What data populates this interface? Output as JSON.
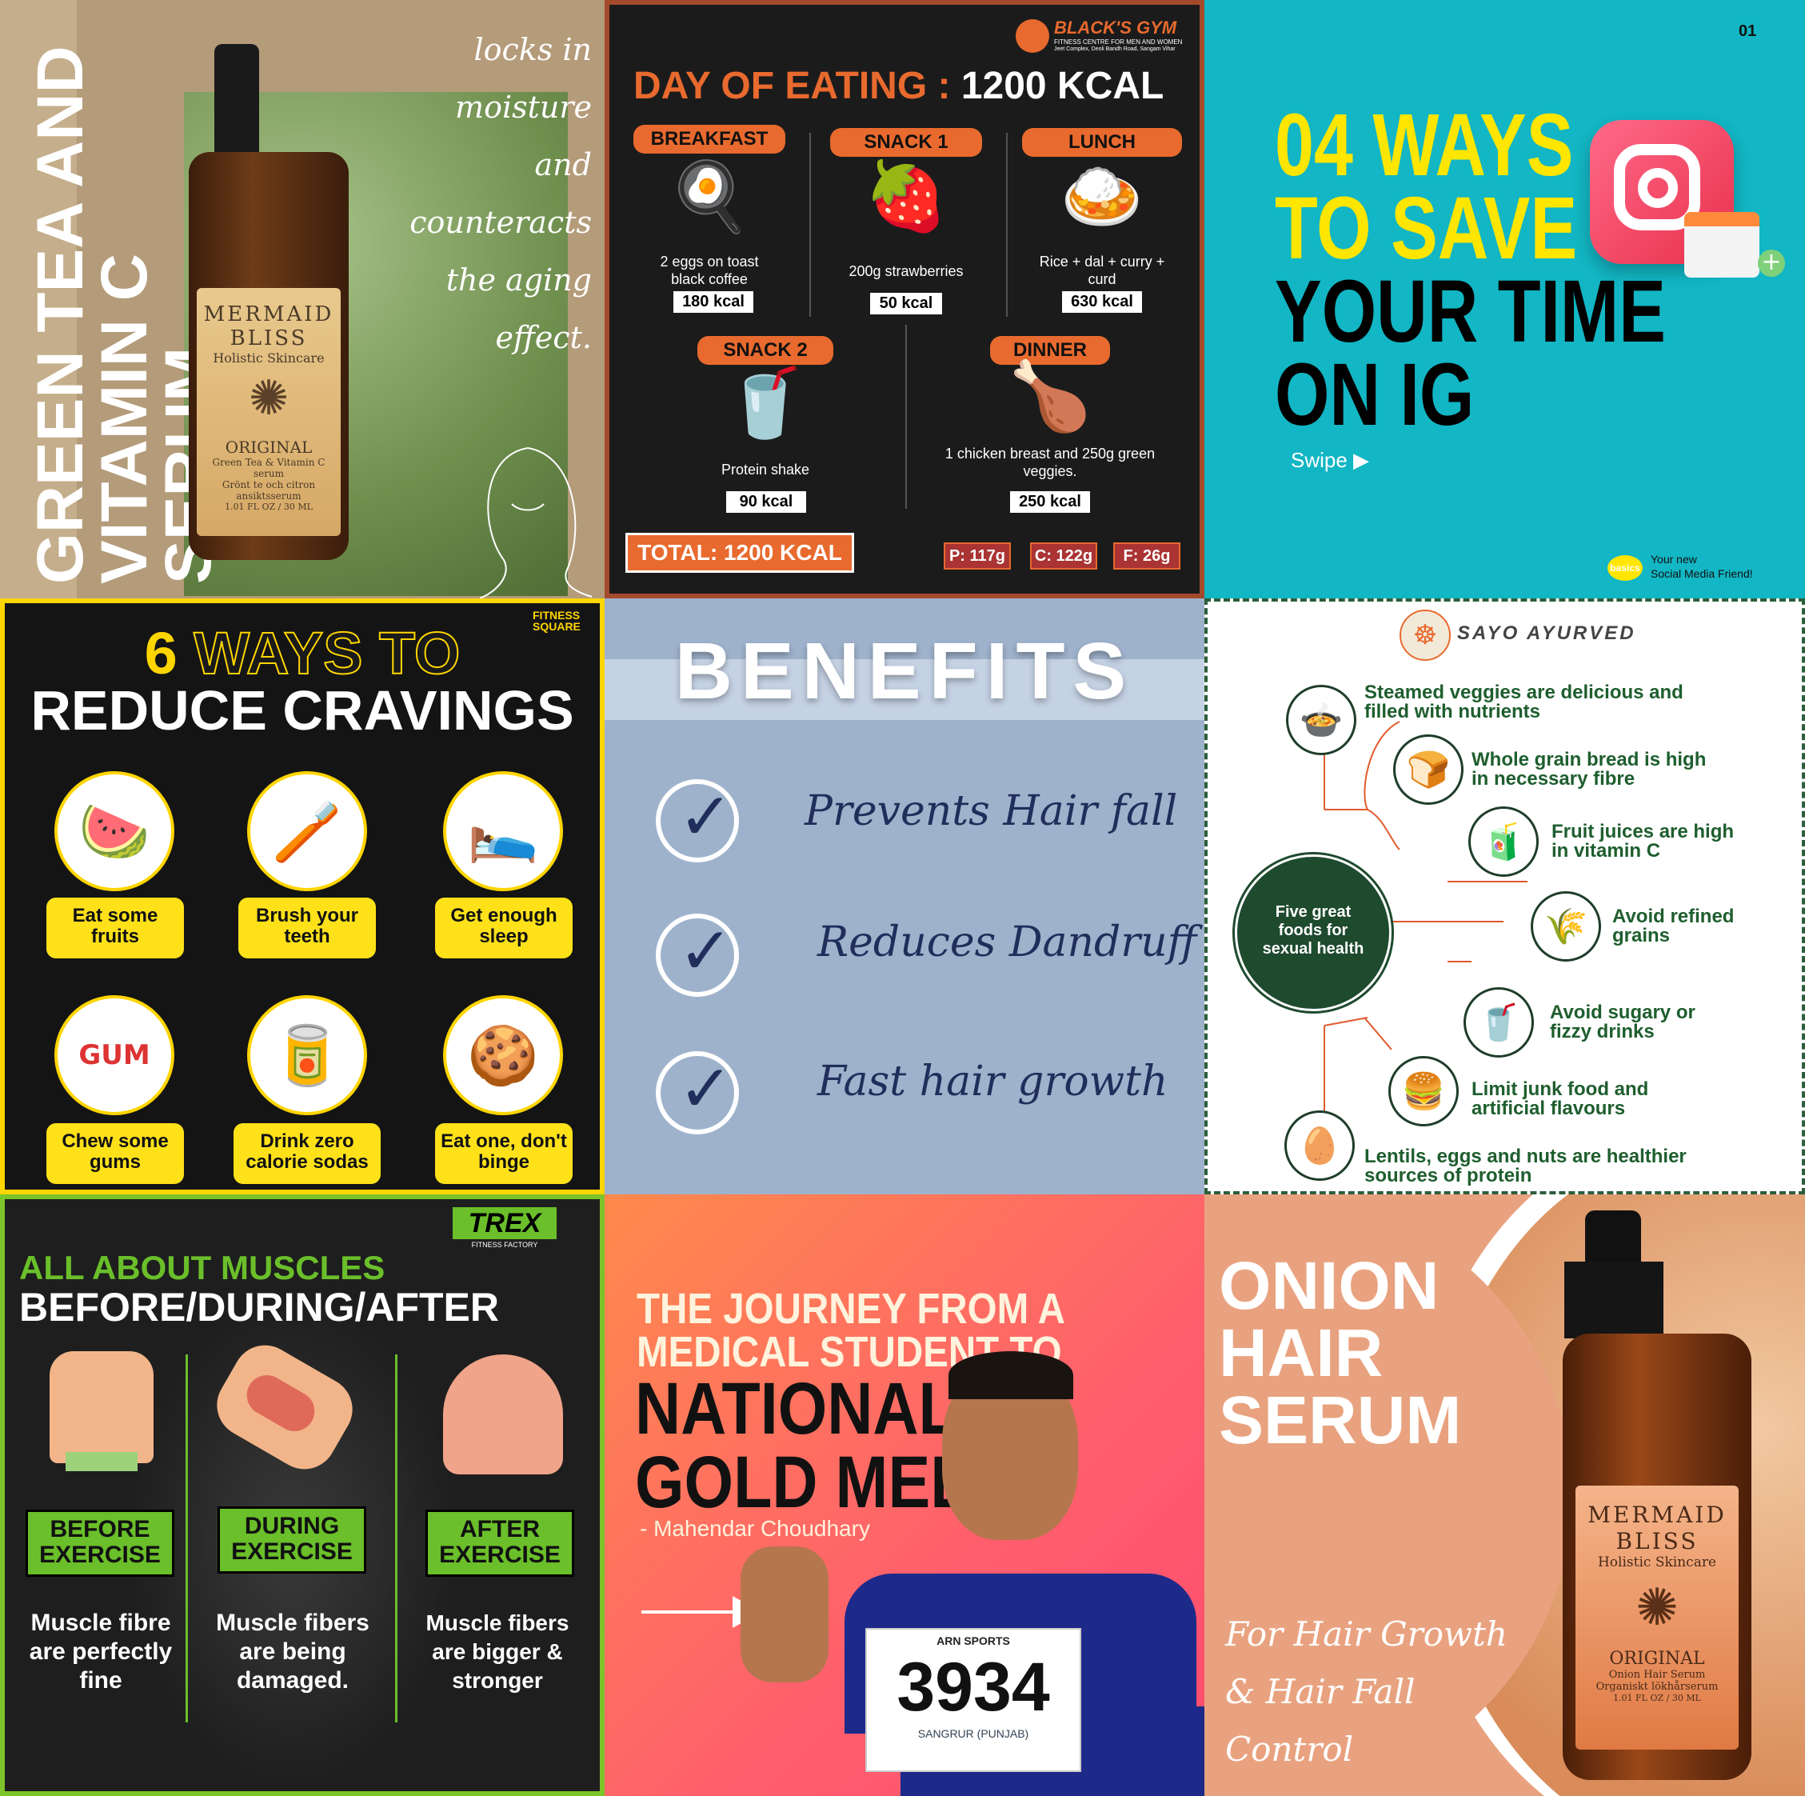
{
  "serum_tile": {
    "title_line1": "GREEN TEA AND",
    "title_line2": "VITAMIN C SERUM",
    "script_line1": "locks in moisture",
    "script_line2": "and counteracts",
    "script_line3": "the aging effect.",
    "bottle_brand1": "MERMAID",
    "bottle_brand2": "BLISS",
    "bottle_sub": "Holistic Skincare",
    "bottle_original": "ORIGINAL",
    "bottle_desc1": "Green Tea & Vitamin C serum",
    "bottle_desc2": "Grönt te och citron ansiktsserum",
    "bottle_size": "1.01 FL OZ / 30 ML"
  },
  "eating_tile": {
    "logo": "BLACK'S GYM",
    "logo_sub": "FITNESS CENTRE FOR MEN AND WOMEN",
    "logo_addr": "Jeet Complex, Deoli Bandh Road, Sangam Vihar",
    "title": "DAY OF EATING :",
    "title_kcal": "1200 KCAL",
    "meals": [
      {
        "label": "BREAKFAST",
        "desc": "2 eggs on toast black coffee",
        "kcal": "180 kcal",
        "icon": "🍳"
      },
      {
        "label": "SNACK 1",
        "desc": "200g strawberries",
        "kcal": "50 kcal",
        "icon": "🍓"
      },
      {
        "label": "LUNCH",
        "desc": "Rice + dal + curry + curd",
        "kcal": "630 kcal",
        "icon": "🍛"
      },
      {
        "label": "SNACK 2",
        "desc": "Protein shake",
        "kcal": "90 kcal",
        "icon": "🥤"
      },
      {
        "label": "DINNER",
        "desc": "1 chicken breast and 250g green veggies.",
        "kcal": "250 kcal",
        "icon": "🍗"
      }
    ],
    "total": "TOTAL: 1200 KCAL",
    "macros": [
      "P: 117g",
      "C: 122g",
      "F: 26g"
    ]
  },
  "ig_tile": {
    "page_num": "01",
    "line1": "04 WAYS",
    "line2": "TO SAVE",
    "line3": "YOUR TIME",
    "line4": "ON IG",
    "swipe": "Swipe ▶",
    "badge": "basics",
    "tagline1": "Your new",
    "tagline2": "Social Media Friend!"
  },
  "cravings_tile": {
    "logo": "FITNESS SQUARE",
    "title_num": "6",
    "title_rest": "WAYS TO",
    "title_line2": "REDUCE CRAVINGS",
    "items": [
      {
        "label": "Eat some fruits",
        "icon": "🍉"
      },
      {
        "label": "Brush your teeth",
        "icon": "🪥"
      },
      {
        "label": "Get enough sleep",
        "icon": "🛌"
      },
      {
        "label": "Chew some gums",
        "icon": "GUM"
      },
      {
        "label": "Drink zero calorie sodas",
        "icon": "🥫"
      },
      {
        "label": "Eat one, don't binge",
        "icon": "🍪"
      }
    ]
  },
  "benefits_tile": {
    "title": "BENEFITS",
    "items": [
      "Prevents Hair fall",
      "Reduces Dandruff",
      "Fast hair growth"
    ]
  },
  "ayurved_tile": {
    "brand": "SAYO AYURVED",
    "center": "Five great foods for sexual health",
    "items": [
      {
        "line1": "Steamed veggies are delicious and",
        "line2": "filled with nutrients",
        "icon": "🍲"
      },
      {
        "line1": "Whole grain bread is high",
        "line2": "in necessary fibre",
        "icon": "🍞"
      },
      {
        "line1": "Fruit juices are high",
        "line2": "in vitamin C",
        "icon": "🧃"
      },
      {
        "line1": "Avoid refined",
        "line2": "grains",
        "icon": "🌾"
      },
      {
        "line1": "Avoid sugary or",
        "line2": "fizzy drinks",
        "icon": "🥤"
      },
      {
        "line1": "Limit junk food and",
        "line2": "artificial flavours",
        "icon": "🍔"
      },
      {
        "line1": "Lentils, eggs and nuts are healthier",
        "line2": "sources of protein",
        "icon": "🥚"
      }
    ]
  },
  "muscles_tile": {
    "logo": "TREX",
    "logo_sub": "FITNESS FACTORY",
    "title1": "ALL ABOUT MUSCLES",
    "title2": "BEFORE/DURING/AFTER",
    "cols": [
      {
        "label1": "BEFORE",
        "label2": "EXERCISE",
        "desc": "Muscle fibre are perfectly fine"
      },
      {
        "label1": "DURING",
        "label2": "EXERCISE",
        "desc": "Muscle fibers are being damaged."
      },
      {
        "label1": "AFTER",
        "label2": "EXERCISE",
        "desc": "Muscle fibers are bigger & stronger"
      }
    ]
  },
  "journey_tile": {
    "line1": "THE JOURNEY FROM A",
    "line2": "MEDICAL STUDENT TO",
    "line3": "NATIONAL",
    "line4": "GOLD MEDAL",
    "author": "- Mahendar Choudhary",
    "bib_top": "ARN SPORTS",
    "bib_num": "3934",
    "bib_bottom": "SANGRUR (PUNJAB)"
  },
  "onion_tile": {
    "line1": "ONION",
    "line2": "HAIR",
    "line3": "SERUM",
    "script1": "For Hair Growth",
    "script2": "& Hair Fall",
    "script3": "Control",
    "bottle_brand1": "MERMAID",
    "bottle_brand2": "BLISS",
    "bottle_sub": "Holistic Skincare",
    "bottle_original": "ORIGINAL",
    "bottle_desc1": "Onion Hair Serum",
    "bottle_desc2": "Organiskt lökhårserum",
    "bottle_size": "1.01 FL OZ / 30 ML"
  }
}
